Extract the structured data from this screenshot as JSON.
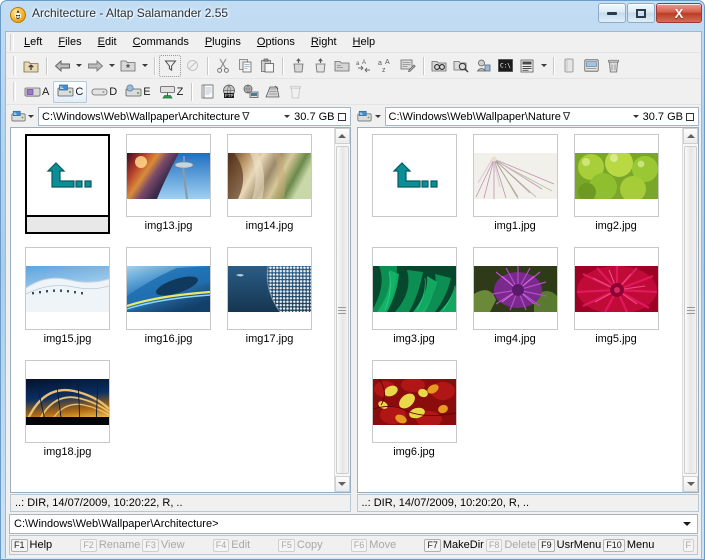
{
  "window": {
    "title": "Architecture - Altap Salamander 2.55",
    "icon": "salamander-icon",
    "buttons": {
      "minimize": "minimize-button",
      "maximize": "maximize-button",
      "close": "close-button",
      "close_glyph": "X"
    }
  },
  "menu": {
    "items": [
      {
        "label": "Left",
        "accel": "L"
      },
      {
        "label": "Files",
        "accel": "F"
      },
      {
        "label": "Edit",
        "accel": "E"
      },
      {
        "label": "Commands",
        "accel": "C"
      },
      {
        "label": "Plugins",
        "accel": "P"
      },
      {
        "label": "Options",
        "accel": "O"
      },
      {
        "label": "Right",
        "accel": "R"
      },
      {
        "label": "Help",
        "accel": "H"
      }
    ]
  },
  "toolbar_main": {
    "groups": [
      [
        "parent-folder-icon"
      ],
      [
        "back-icon",
        "back-dropdown-icon",
        "forward-icon",
        "forward-dropdown-icon",
        "hot-paths-icon",
        "hot-paths-dropdown-icon"
      ],
      [
        "filter-icon",
        "no-filter-icon"
      ],
      [
        "cut-icon",
        "copy-icon",
        "paste-icon"
      ],
      [
        "copy-files-icon",
        "move-files-icon",
        "new-folder-icon",
        "change-attributes-icon",
        "change-case-icon",
        "batch-rename-icon"
      ],
      [
        "find-files-icon",
        "compare-directories-icon",
        "connect-ftp-icon",
        "open-console-icon",
        "view-mode-icon",
        "view-mode-dropdown-icon"
      ],
      [
        "pack-icon",
        "properties-icon",
        "delete-icon"
      ]
    ]
  },
  "toolbar_drives": {
    "drives": [
      {
        "letter": "A",
        "icon": "floppy-drive-icon",
        "active": false
      },
      {
        "letter": "C",
        "icon": "hard-drive-icon",
        "active": true
      },
      {
        "letter": "D",
        "icon": "cd-drive-icon",
        "active": false
      },
      {
        "letter": "E",
        "icon": "removable-drive-icon",
        "active": false
      },
      {
        "letter": "Z",
        "icon": "network-drive-icon",
        "active": false
      }
    ],
    "extras": [
      "documents-icon",
      "ftp-icon",
      "network-icon",
      "another-panel-icon",
      "trash-icon"
    ]
  },
  "panels": {
    "left": {
      "drive_icon": "hard-drive-icon",
      "path": "C:\\Windows\\Web\\Wallpaper\\Architecture",
      "filter_glyph": "∇",
      "free_space": "30.7 GB",
      "info_line": "..: DIR, 14/07/2009, 10:20:22, R, ..",
      "items": [
        {
          "name": "..",
          "type": "parent",
          "selected": true
        },
        {
          "name": "img13.jpg",
          "type": "image",
          "selected": false
        },
        {
          "name": "img14.jpg",
          "type": "image",
          "selected": false
        },
        {
          "name": "img15.jpg",
          "type": "image",
          "selected": false
        },
        {
          "name": "img16.jpg",
          "type": "image",
          "selected": false
        },
        {
          "name": "img17.jpg",
          "type": "image",
          "selected": false
        },
        {
          "name": "img18.jpg",
          "type": "image",
          "selected": false
        }
      ]
    },
    "right": {
      "drive_icon": "hard-drive-icon",
      "path": "C:\\Windows\\Web\\Wallpaper\\Nature",
      "filter_glyph": "∇",
      "free_space": "30.7 GB",
      "info_line": "..: DIR, 14/07/2009, 10:20:20, R, ..",
      "items": [
        {
          "name": "..",
          "type": "parent",
          "selected": false
        },
        {
          "name": "img1.jpg",
          "type": "image",
          "selected": false
        },
        {
          "name": "img2.jpg",
          "type": "image",
          "selected": false
        },
        {
          "name": "img3.jpg",
          "type": "image",
          "selected": false
        },
        {
          "name": "img4.jpg",
          "type": "image",
          "selected": false
        },
        {
          "name": "img5.jpg",
          "type": "image",
          "selected": false
        },
        {
          "name": "img6.jpg",
          "type": "image",
          "selected": false
        }
      ]
    }
  },
  "command_line": {
    "prompt": "C:\\Windows\\Web\\Wallpaper\\Architecture>"
  },
  "function_keys": [
    {
      "key": "F1",
      "label": "Help",
      "enabled": true
    },
    {
      "key": "F2",
      "label": "Rename",
      "enabled": false
    },
    {
      "key": "F3",
      "label": "View",
      "enabled": false
    },
    {
      "key": "F4",
      "label": "Edit",
      "enabled": false
    },
    {
      "key": "F5",
      "label": "Copy",
      "enabled": false
    },
    {
      "key": "F6",
      "label": "Move",
      "enabled": false
    },
    {
      "key": "F7",
      "label": "MakeDir",
      "enabled": true
    },
    {
      "key": "F8",
      "label": "Delete",
      "enabled": false
    },
    {
      "key": "F9",
      "label": "UsrMenu",
      "enabled": true
    },
    {
      "key": "F10",
      "label": "Menu",
      "enabled": true
    },
    {
      "key": "F",
      "label": "",
      "enabled": false
    }
  ],
  "colors": {
    "accent": "#b4d4ef",
    "close_button": "#bb3b26",
    "selection_border": "#000000",
    "parent_arrow": "#0a8f97"
  }
}
